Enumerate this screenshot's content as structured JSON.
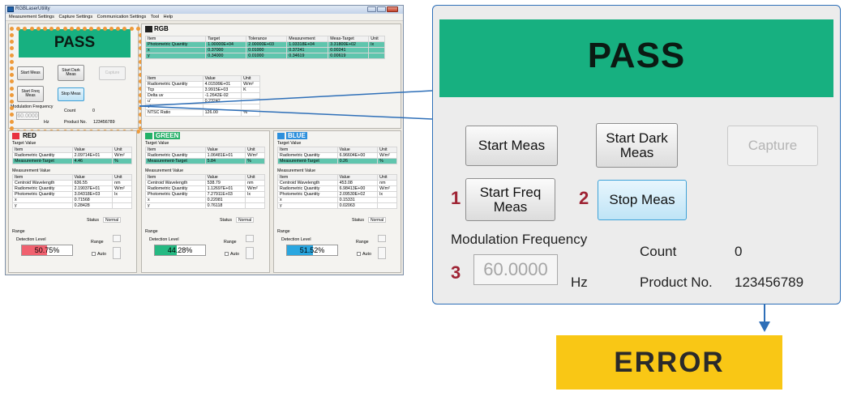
{
  "window": {
    "title": "RGBLaserUtility",
    "menu": [
      "Measurement Settings",
      "Capture Settings",
      "Communication Settings",
      "Tool",
      "Help"
    ]
  },
  "control": {
    "pass": "PASS",
    "start_meas": "Start Meas",
    "start_dark": "Start Dark Meas",
    "capture": "Capture",
    "start_freq": "Start Freq Meas",
    "stop_meas": "Stop Meas",
    "mod_freq_label": "Modulation Frequency",
    "freq_value": "60.0000",
    "hz": "Hz",
    "count_label": "Count",
    "count_value": "0",
    "product_label": "Product No.",
    "product_value": "123456789"
  },
  "rgb": {
    "title": "RGB",
    "cols": [
      "Item",
      "Target",
      "Tolerance",
      "Measurement",
      "Meas-Target",
      "Unit"
    ],
    "rows": [
      [
        "Photometric Quantity",
        "1.00000E+04",
        "2.00000E+03",
        "1.03318E+04",
        "3.31800E+02",
        "lx"
      ],
      [
        "x",
        "0.37000",
        "0.01000",
        "0.37241",
        "0.00241",
        ""
      ],
      [
        "y",
        "0.34000",
        "0.01000",
        "0.34619",
        "0.00619",
        ""
      ]
    ],
    "cols2": [
      "Item",
      "Value",
      "Unit"
    ],
    "rows2": [
      [
        "Radiometric Quantity",
        "4.01599E+01",
        "W/m²"
      ],
      [
        "Tcp",
        "3.9915E+03",
        "K"
      ],
      [
        "Delta uv",
        "-1.2642E-02",
        ""
      ],
      [
        "u'",
        "0.23242",
        ""
      ],
      [
        "v'",
        "",
        ""
      ],
      [
        "NTSC Ratio",
        "126.00",
        "%"
      ]
    ]
  },
  "channels": [
    {
      "title": "RED",
      "target_label": "Target Value",
      "target_rows": [
        [
          "Item",
          "Value",
          "Unit"
        ],
        [
          "Radiometric Quantity",
          "2.09714E+01",
          "W/m²"
        ],
        [
          "Measurement-Target",
          "4.46",
          "%"
        ]
      ],
      "meas_label": "Measurement Value",
      "meas_rows": [
        [
          "Item",
          "Value",
          "Unit"
        ],
        [
          "Centroid Wavelength",
          "636.55",
          "nm"
        ],
        [
          "Radiometric Quantity",
          "2.19037E+01",
          "W/m²"
        ],
        [
          "Photometric Quantity",
          "3.04318E+03",
          "lx"
        ],
        [
          "x",
          "0.71568",
          ""
        ],
        [
          "y",
          "0.28428",
          ""
        ]
      ],
      "status_label": "Status",
      "status": "Normal",
      "range_label": "Range",
      "detect_label": "Detection Level",
      "range_small": "Range",
      "auto": "Auto",
      "level": "50.75%",
      "level_frac": 0.5075,
      "color": "#f0616f"
    },
    {
      "title": "GREEN",
      "target_label": "Target Value",
      "target_rows": [
        [
          "Item",
          "Value",
          "Unit"
        ],
        [
          "Radiometric Quantity",
          "1.06481E+01",
          "W/m²"
        ],
        [
          "Measurement-Target",
          "5.84",
          "%"
        ]
      ],
      "meas_label": "Measurement Value",
      "meas_rows": [
        [
          "Item",
          "Value",
          "Unit"
        ],
        [
          "Centroid Wavelength",
          "538.79",
          "nm"
        ],
        [
          "Radiometric Quantity",
          "1.12697E+01",
          "W/m²"
        ],
        [
          "Photometric Quantity",
          "7.27911E+03",
          "lx"
        ],
        [
          "x",
          "0.22081",
          ""
        ],
        [
          "y",
          "0.76118",
          ""
        ]
      ],
      "status_label": "Status",
      "status": "Normal",
      "range_label": "Range",
      "detect_label": "Detection Level",
      "range_small": "Range",
      "auto": "Auto",
      "level": "44.28%",
      "level_frac": 0.4428,
      "color": "#25b982"
    },
    {
      "title": "BLUE",
      "target_label": "Target Value",
      "target_rows": [
        [
          "Item",
          "Value",
          "Unit"
        ],
        [
          "Radiometric Quantity",
          "6.96604E+00",
          "W/m²"
        ],
        [
          "Measurement-Target",
          "0.26",
          "%"
        ]
      ],
      "meas_label": "Measurement Value",
      "meas_rows": [
        [
          "Item",
          "Value",
          "Unit"
        ],
        [
          "Centroid Wavelength",
          "453.08",
          "nm"
        ],
        [
          "Radiometric Quantity",
          "6.98413E+00",
          "W/m²"
        ],
        [
          "Photometric Quantity",
          "2.09530E+02",
          "lx"
        ],
        [
          "x",
          "0.15331",
          ""
        ],
        [
          "y",
          "0.02063",
          ""
        ]
      ],
      "status_label": "Status",
      "status": "Normal",
      "range_label": "Range",
      "detect_label": "Detection Level",
      "range_small": "Range",
      "auto": "Auto",
      "level": "51.52%",
      "level_frac": 0.5152,
      "color": "#29a6e0"
    }
  ],
  "zoom": {
    "num1": "1",
    "num2": "2",
    "num3": "3"
  },
  "error": "ERROR",
  "colors": {
    "pass_green": "#17b080",
    "error_yellow": "#f9c715",
    "dot_orange": "#ee9a3a",
    "highlight": "#5fc5ad"
  }
}
